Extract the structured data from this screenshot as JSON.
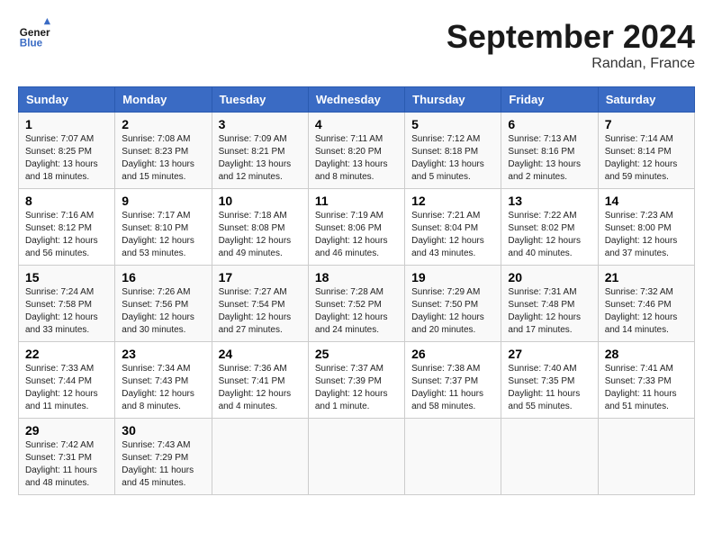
{
  "logo": {
    "text1": "General",
    "text2": "Blue"
  },
  "title": "September 2024",
  "subtitle": "Randan, France",
  "headers": [
    "Sunday",
    "Monday",
    "Tuesday",
    "Wednesday",
    "Thursday",
    "Friday",
    "Saturday"
  ],
  "weeks": [
    [
      {
        "day": "1",
        "info": "Sunrise: 7:07 AM\nSunset: 8:25 PM\nDaylight: 13 hours\nand 18 minutes."
      },
      {
        "day": "2",
        "info": "Sunrise: 7:08 AM\nSunset: 8:23 PM\nDaylight: 13 hours\nand 15 minutes."
      },
      {
        "day": "3",
        "info": "Sunrise: 7:09 AM\nSunset: 8:21 PM\nDaylight: 13 hours\nand 12 minutes."
      },
      {
        "day": "4",
        "info": "Sunrise: 7:11 AM\nSunset: 8:20 PM\nDaylight: 13 hours\nand 8 minutes."
      },
      {
        "day": "5",
        "info": "Sunrise: 7:12 AM\nSunset: 8:18 PM\nDaylight: 13 hours\nand 5 minutes."
      },
      {
        "day": "6",
        "info": "Sunrise: 7:13 AM\nSunset: 8:16 PM\nDaylight: 13 hours\nand 2 minutes."
      },
      {
        "day": "7",
        "info": "Sunrise: 7:14 AM\nSunset: 8:14 PM\nDaylight: 12 hours\nand 59 minutes."
      }
    ],
    [
      {
        "day": "8",
        "info": "Sunrise: 7:16 AM\nSunset: 8:12 PM\nDaylight: 12 hours\nand 56 minutes."
      },
      {
        "day": "9",
        "info": "Sunrise: 7:17 AM\nSunset: 8:10 PM\nDaylight: 12 hours\nand 53 minutes."
      },
      {
        "day": "10",
        "info": "Sunrise: 7:18 AM\nSunset: 8:08 PM\nDaylight: 12 hours\nand 49 minutes."
      },
      {
        "day": "11",
        "info": "Sunrise: 7:19 AM\nSunset: 8:06 PM\nDaylight: 12 hours\nand 46 minutes."
      },
      {
        "day": "12",
        "info": "Sunrise: 7:21 AM\nSunset: 8:04 PM\nDaylight: 12 hours\nand 43 minutes."
      },
      {
        "day": "13",
        "info": "Sunrise: 7:22 AM\nSunset: 8:02 PM\nDaylight: 12 hours\nand 40 minutes."
      },
      {
        "day": "14",
        "info": "Sunrise: 7:23 AM\nSunset: 8:00 PM\nDaylight: 12 hours\nand 37 minutes."
      }
    ],
    [
      {
        "day": "15",
        "info": "Sunrise: 7:24 AM\nSunset: 7:58 PM\nDaylight: 12 hours\nand 33 minutes."
      },
      {
        "day": "16",
        "info": "Sunrise: 7:26 AM\nSunset: 7:56 PM\nDaylight: 12 hours\nand 30 minutes."
      },
      {
        "day": "17",
        "info": "Sunrise: 7:27 AM\nSunset: 7:54 PM\nDaylight: 12 hours\nand 27 minutes."
      },
      {
        "day": "18",
        "info": "Sunrise: 7:28 AM\nSunset: 7:52 PM\nDaylight: 12 hours\nand 24 minutes."
      },
      {
        "day": "19",
        "info": "Sunrise: 7:29 AM\nSunset: 7:50 PM\nDaylight: 12 hours\nand 20 minutes."
      },
      {
        "day": "20",
        "info": "Sunrise: 7:31 AM\nSunset: 7:48 PM\nDaylight: 12 hours\nand 17 minutes."
      },
      {
        "day": "21",
        "info": "Sunrise: 7:32 AM\nSunset: 7:46 PM\nDaylight: 12 hours\nand 14 minutes."
      }
    ],
    [
      {
        "day": "22",
        "info": "Sunrise: 7:33 AM\nSunset: 7:44 PM\nDaylight: 12 hours\nand 11 minutes."
      },
      {
        "day": "23",
        "info": "Sunrise: 7:34 AM\nSunset: 7:43 PM\nDaylight: 12 hours\nand 8 minutes."
      },
      {
        "day": "24",
        "info": "Sunrise: 7:36 AM\nSunset: 7:41 PM\nDaylight: 12 hours\nand 4 minutes."
      },
      {
        "day": "25",
        "info": "Sunrise: 7:37 AM\nSunset: 7:39 PM\nDaylight: 12 hours\nand 1 minute."
      },
      {
        "day": "26",
        "info": "Sunrise: 7:38 AM\nSunset: 7:37 PM\nDaylight: 11 hours\nand 58 minutes."
      },
      {
        "day": "27",
        "info": "Sunrise: 7:40 AM\nSunset: 7:35 PM\nDaylight: 11 hours\nand 55 minutes."
      },
      {
        "day": "28",
        "info": "Sunrise: 7:41 AM\nSunset: 7:33 PM\nDaylight: 11 hours\nand 51 minutes."
      }
    ],
    [
      {
        "day": "29",
        "info": "Sunrise: 7:42 AM\nSunset: 7:31 PM\nDaylight: 11 hours\nand 48 minutes."
      },
      {
        "day": "30",
        "info": "Sunrise: 7:43 AM\nSunset: 7:29 PM\nDaylight: 11 hours\nand 45 minutes."
      },
      null,
      null,
      null,
      null,
      null
    ]
  ]
}
